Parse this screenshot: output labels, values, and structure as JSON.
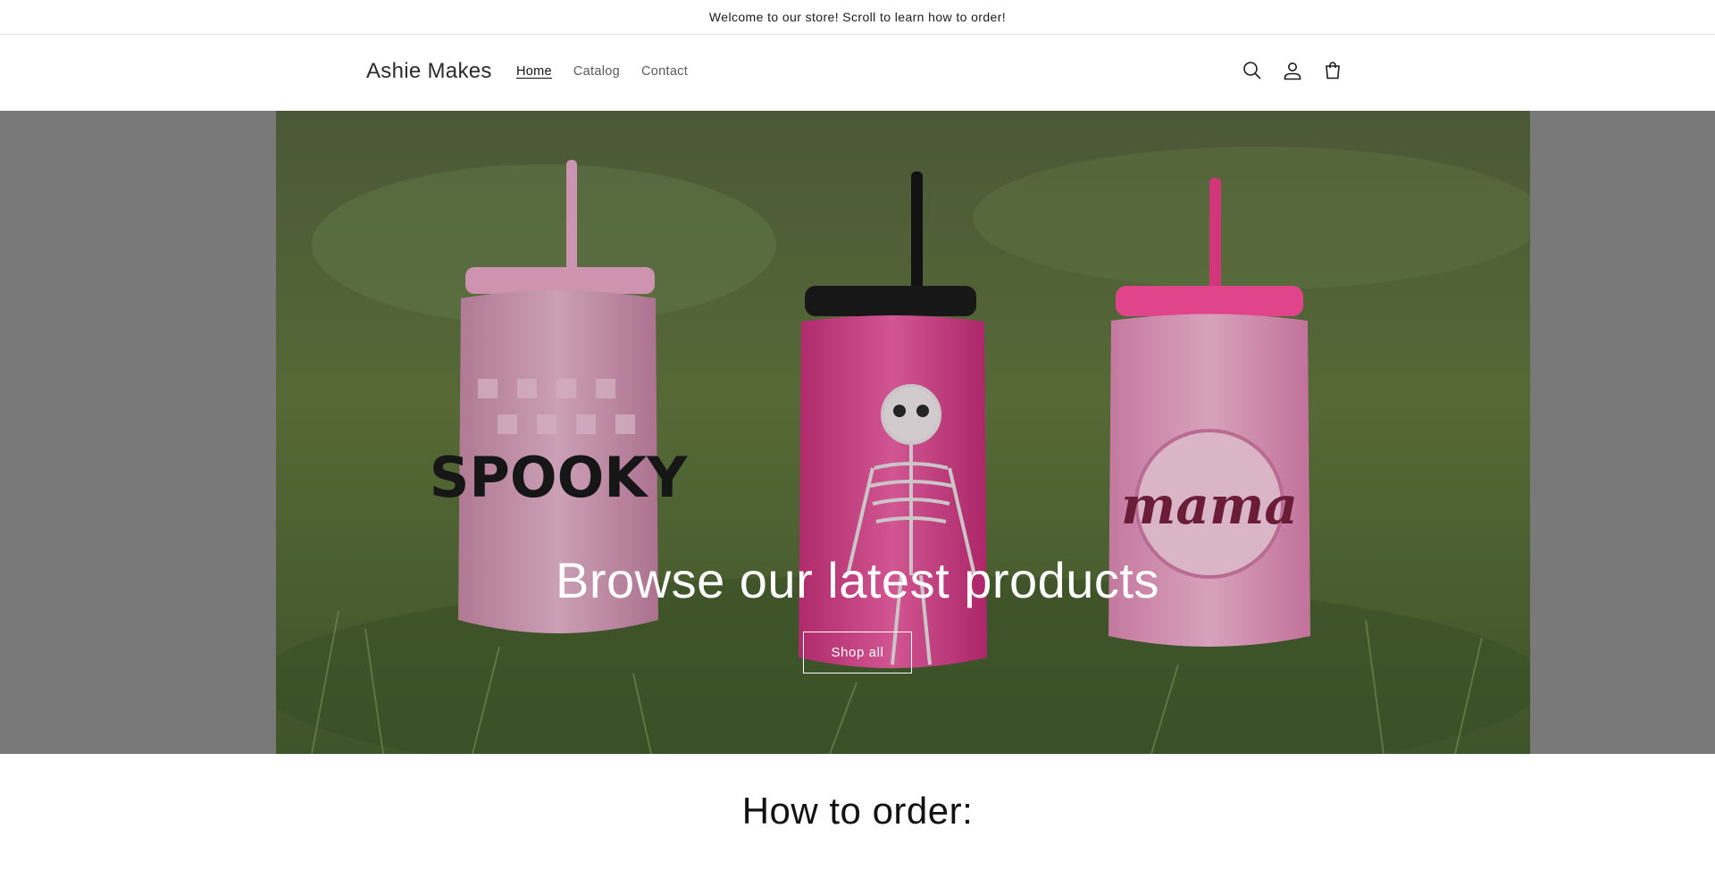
{
  "announcement": {
    "text": "Welcome to our store! Scroll to learn how to order!"
  },
  "header": {
    "logo": "Ashie Makes",
    "nav": [
      {
        "label": "Home",
        "active": true
      },
      {
        "label": "Catalog",
        "active": false
      },
      {
        "label": "Contact",
        "active": false
      }
    ],
    "icons": [
      "search-icon",
      "account-icon",
      "cart-icon"
    ]
  },
  "hero": {
    "title": "Browse our latest products",
    "button_label": "Shop all",
    "image_alt": "Three glitter tumblers with straws on grass",
    "tumbler_labels": [
      "SPOOKY",
      "mama"
    ]
  },
  "sections": {
    "how_to_order_title": "How to order:"
  },
  "colors": {
    "light_pink": "#e6a9c8",
    "hot_pink": "#e94c98",
    "magenta": "#ff4fa0",
    "grass_green": "#5d7a48"
  }
}
